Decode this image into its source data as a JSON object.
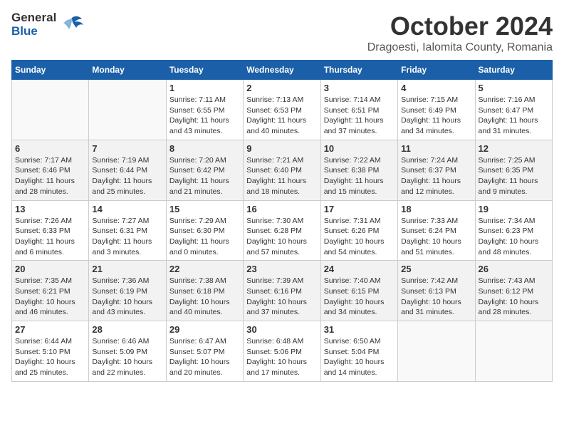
{
  "header": {
    "logo_general": "General",
    "logo_blue": "Blue",
    "month": "October 2024",
    "location": "Dragoesti, Ialomita County, Romania"
  },
  "weekdays": [
    "Sunday",
    "Monday",
    "Tuesday",
    "Wednesday",
    "Thursday",
    "Friday",
    "Saturday"
  ],
  "weeks": [
    [
      {
        "day": "",
        "info": ""
      },
      {
        "day": "",
        "info": ""
      },
      {
        "day": "1",
        "info": "Sunrise: 7:11 AM\nSunset: 6:55 PM\nDaylight: 11 hours and 43 minutes."
      },
      {
        "day": "2",
        "info": "Sunrise: 7:13 AM\nSunset: 6:53 PM\nDaylight: 11 hours and 40 minutes."
      },
      {
        "day": "3",
        "info": "Sunrise: 7:14 AM\nSunset: 6:51 PM\nDaylight: 11 hours and 37 minutes."
      },
      {
        "day": "4",
        "info": "Sunrise: 7:15 AM\nSunset: 6:49 PM\nDaylight: 11 hours and 34 minutes."
      },
      {
        "day": "5",
        "info": "Sunrise: 7:16 AM\nSunset: 6:47 PM\nDaylight: 11 hours and 31 minutes."
      }
    ],
    [
      {
        "day": "6",
        "info": "Sunrise: 7:17 AM\nSunset: 6:46 PM\nDaylight: 11 hours and 28 minutes."
      },
      {
        "day": "7",
        "info": "Sunrise: 7:19 AM\nSunset: 6:44 PM\nDaylight: 11 hours and 25 minutes."
      },
      {
        "day": "8",
        "info": "Sunrise: 7:20 AM\nSunset: 6:42 PM\nDaylight: 11 hours and 21 minutes."
      },
      {
        "day": "9",
        "info": "Sunrise: 7:21 AM\nSunset: 6:40 PM\nDaylight: 11 hours and 18 minutes."
      },
      {
        "day": "10",
        "info": "Sunrise: 7:22 AM\nSunset: 6:38 PM\nDaylight: 11 hours and 15 minutes."
      },
      {
        "day": "11",
        "info": "Sunrise: 7:24 AM\nSunset: 6:37 PM\nDaylight: 11 hours and 12 minutes."
      },
      {
        "day": "12",
        "info": "Sunrise: 7:25 AM\nSunset: 6:35 PM\nDaylight: 11 hours and 9 minutes."
      }
    ],
    [
      {
        "day": "13",
        "info": "Sunrise: 7:26 AM\nSunset: 6:33 PM\nDaylight: 11 hours and 6 minutes."
      },
      {
        "day": "14",
        "info": "Sunrise: 7:27 AM\nSunset: 6:31 PM\nDaylight: 11 hours and 3 minutes."
      },
      {
        "day": "15",
        "info": "Sunrise: 7:29 AM\nSunset: 6:30 PM\nDaylight: 11 hours and 0 minutes."
      },
      {
        "day": "16",
        "info": "Sunrise: 7:30 AM\nSunset: 6:28 PM\nDaylight: 10 hours and 57 minutes."
      },
      {
        "day": "17",
        "info": "Sunrise: 7:31 AM\nSunset: 6:26 PM\nDaylight: 10 hours and 54 minutes."
      },
      {
        "day": "18",
        "info": "Sunrise: 7:33 AM\nSunset: 6:24 PM\nDaylight: 10 hours and 51 minutes."
      },
      {
        "day": "19",
        "info": "Sunrise: 7:34 AM\nSunset: 6:23 PM\nDaylight: 10 hours and 48 minutes."
      }
    ],
    [
      {
        "day": "20",
        "info": "Sunrise: 7:35 AM\nSunset: 6:21 PM\nDaylight: 10 hours and 46 minutes."
      },
      {
        "day": "21",
        "info": "Sunrise: 7:36 AM\nSunset: 6:19 PM\nDaylight: 10 hours and 43 minutes."
      },
      {
        "day": "22",
        "info": "Sunrise: 7:38 AM\nSunset: 6:18 PM\nDaylight: 10 hours and 40 minutes."
      },
      {
        "day": "23",
        "info": "Sunrise: 7:39 AM\nSunset: 6:16 PM\nDaylight: 10 hours and 37 minutes."
      },
      {
        "day": "24",
        "info": "Sunrise: 7:40 AM\nSunset: 6:15 PM\nDaylight: 10 hours and 34 minutes."
      },
      {
        "day": "25",
        "info": "Sunrise: 7:42 AM\nSunset: 6:13 PM\nDaylight: 10 hours and 31 minutes."
      },
      {
        "day": "26",
        "info": "Sunrise: 7:43 AM\nSunset: 6:12 PM\nDaylight: 10 hours and 28 minutes."
      }
    ],
    [
      {
        "day": "27",
        "info": "Sunrise: 6:44 AM\nSunset: 5:10 PM\nDaylight: 10 hours and 25 minutes."
      },
      {
        "day": "28",
        "info": "Sunrise: 6:46 AM\nSunset: 5:09 PM\nDaylight: 10 hours and 22 minutes."
      },
      {
        "day": "29",
        "info": "Sunrise: 6:47 AM\nSunset: 5:07 PM\nDaylight: 10 hours and 20 minutes."
      },
      {
        "day": "30",
        "info": "Sunrise: 6:48 AM\nSunset: 5:06 PM\nDaylight: 10 hours and 17 minutes."
      },
      {
        "day": "31",
        "info": "Sunrise: 6:50 AM\nSunset: 5:04 PM\nDaylight: 10 hours and 14 minutes."
      },
      {
        "day": "",
        "info": ""
      },
      {
        "day": "",
        "info": ""
      }
    ]
  ]
}
